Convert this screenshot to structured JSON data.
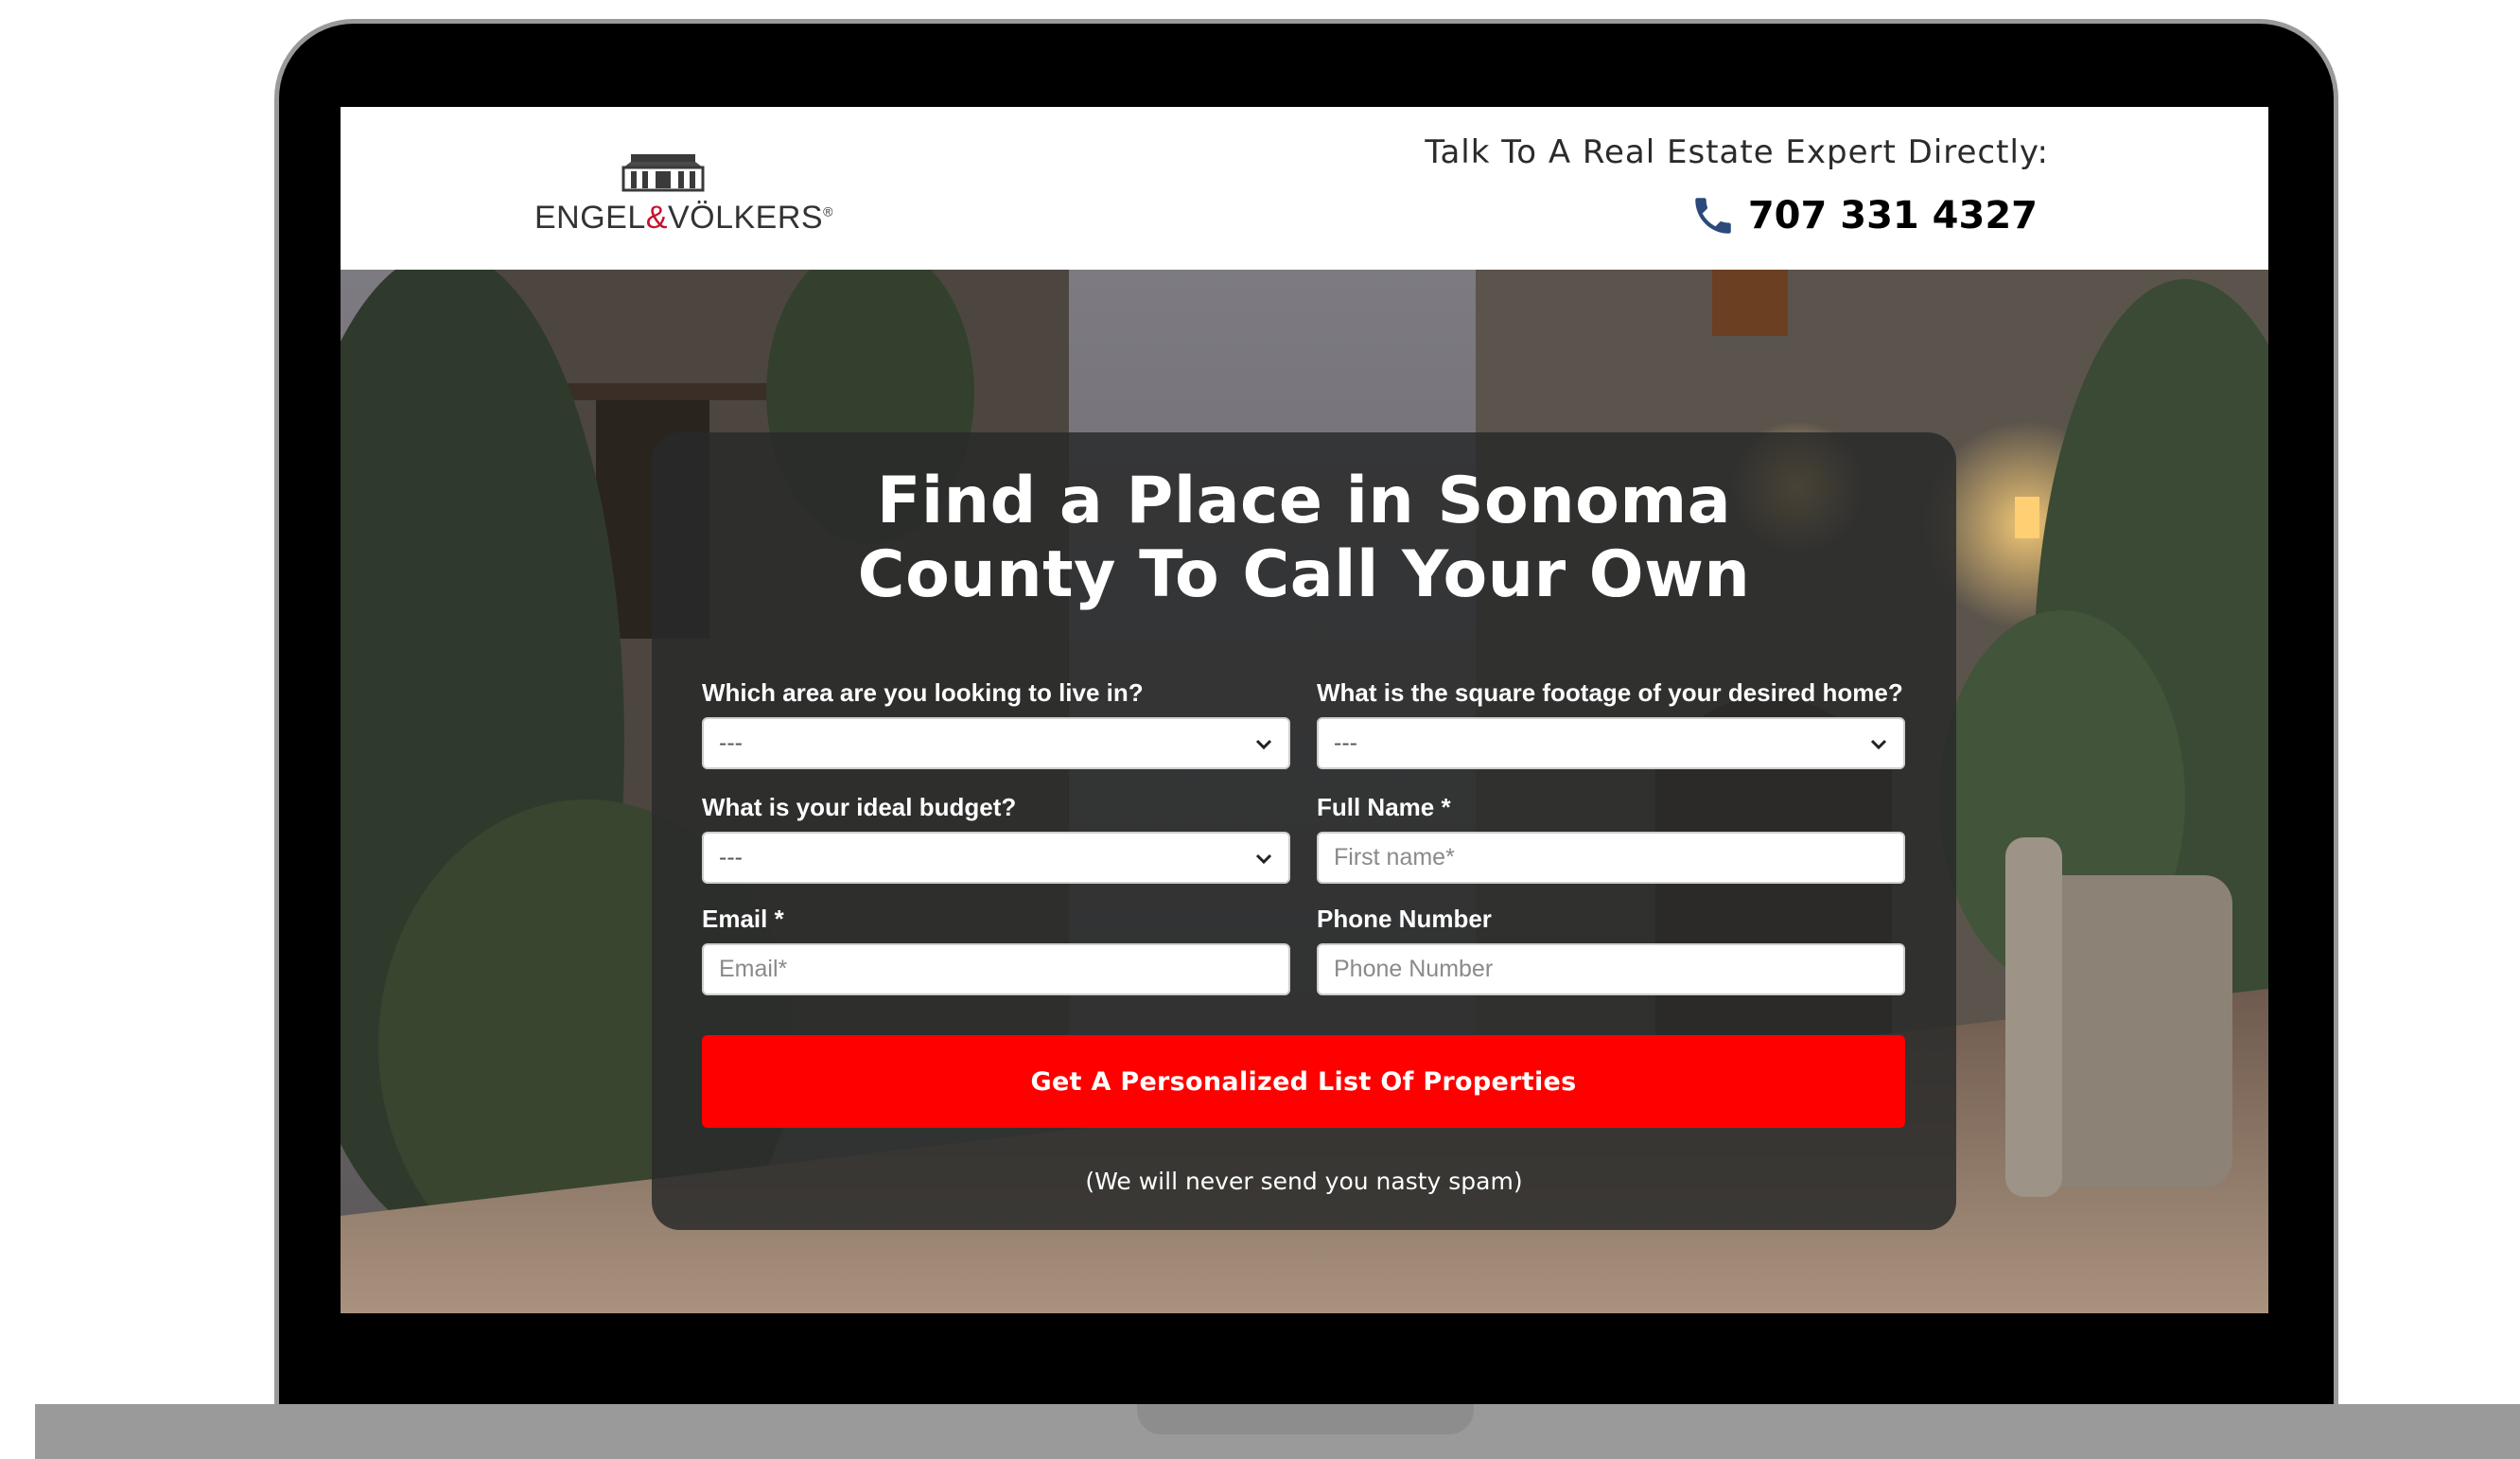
{
  "header": {
    "logo_text_left": "ENGEL",
    "logo_text_amp": "&",
    "logo_text_right": "VÖLKERS",
    "logo_reg": "®",
    "tagline": "Talk To A Real Estate Expert Directly:",
    "phone": "707 331 4327",
    "phone_icon": "phone-icon"
  },
  "form": {
    "title": "Find a Place in Sonoma County To Call Your Own",
    "fields": {
      "area": {
        "label": "Which area are you looking to live in?",
        "value": "---"
      },
      "sqft": {
        "label": "What is the square footage of your desired home?",
        "value": "---"
      },
      "budget": {
        "label": "What is your ideal budget?",
        "value": "---"
      },
      "full_name": {
        "label": "Full Name *",
        "placeholder": "First name*"
      },
      "email": {
        "label": "Email *",
        "placeholder": "Email*"
      },
      "phone": {
        "label": "Phone Number",
        "placeholder": "Phone Number"
      }
    },
    "submit_label": "Get A Personalized List Of Properties",
    "spam_note": "(We will never send you nasty spam)"
  },
  "colors": {
    "accent": "#ff0000",
    "logo_amp": "#c8102e",
    "phone_icon": "#2b4a7a",
    "card_bg": "#282a2a"
  }
}
